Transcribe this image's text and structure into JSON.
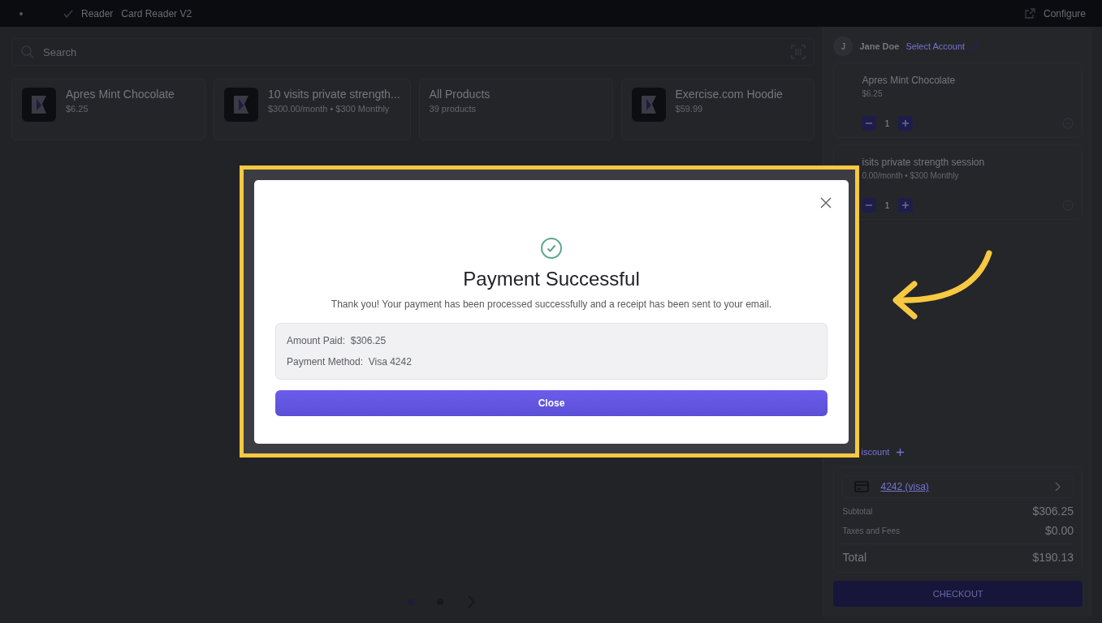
{
  "top_bar": {
    "status": "Reader",
    "device": "Card Reader V2",
    "configure": "Configure"
  },
  "search": {
    "placeholder": "Search"
  },
  "products": [
    {
      "kind": "product",
      "name": "Apres Mint Chocolate",
      "subtitle": "$6.25"
    },
    {
      "kind": "product",
      "name": "10 visits private strength...",
      "subtitle": "$300.00/month • $300 Monthly"
    },
    {
      "kind": "category",
      "name": "All Products",
      "subtitle": "39 products"
    },
    {
      "kind": "product",
      "name": "Exercise.com Hoodie",
      "subtitle": "$59.99"
    }
  ],
  "pagination": [
    {
      "selected": true
    },
    {
      "selected": false
    }
  ],
  "account": {
    "initial": "J",
    "name": "Jane Doe",
    "link": "Select Account"
  },
  "cart": [
    {
      "name": "Apres Mint Chocolate",
      "subtitle": "$6.25",
      "quantity": "1"
    },
    {
      "name": "isits private strength session",
      "subtitle": "0.00/month • $300 Monthly",
      "quantity": "1"
    }
  ],
  "discount": "iscount",
  "payment_method": "4242 (visa)",
  "summary": [
    {
      "kind": "line",
      "label": "Subtotal",
      "value": "$306.25"
    },
    {
      "kind": "line",
      "label": "Taxes and Fees",
      "value": "$0.00"
    },
    {
      "kind": "total",
      "label": "Total",
      "value": "$190.13"
    }
  ],
  "checkout": "CHECKOUT",
  "modal": {
    "title": "Payment Successful",
    "message": "Thank you! Your payment has been processed successfully and a receipt has been sent to your email.",
    "details": [
      {
        "label": "Amount Paid:",
        "value": "$306.25"
      },
      {
        "label": "Payment Method:",
        "value": "Visa 4242"
      }
    ],
    "button": "Close"
  }
}
